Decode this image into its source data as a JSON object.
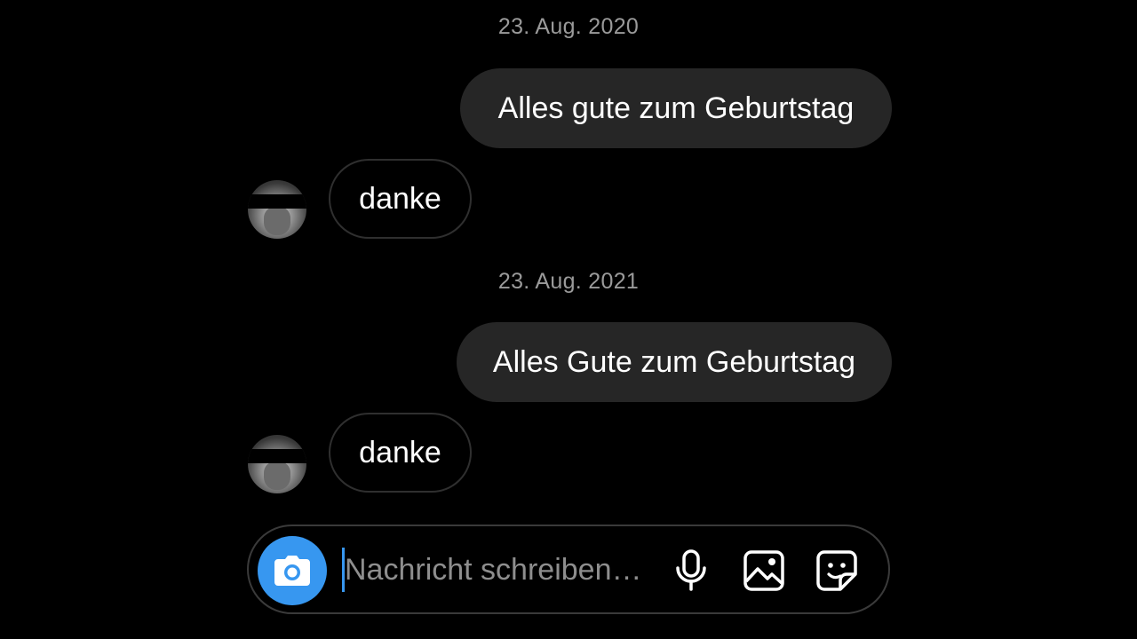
{
  "conversation": {
    "groups": [
      {
        "date": "23. Aug. 2020",
        "sent": "Alles gute zum Geburtstag",
        "received": "danke"
      },
      {
        "date": "23. Aug. 2021",
        "sent": "Alles Gute zum Geburtstag",
        "received": "danke"
      }
    ]
  },
  "composer": {
    "placeholder": "Nachricht schreiben…",
    "icons": [
      "camera-icon",
      "microphone-icon",
      "gallery-icon",
      "sticker-icon"
    ]
  },
  "colors": {
    "background": "#000000",
    "sent_bubble": "#262626",
    "accent": "#3797f0",
    "date_text": "#9a9a9a"
  }
}
